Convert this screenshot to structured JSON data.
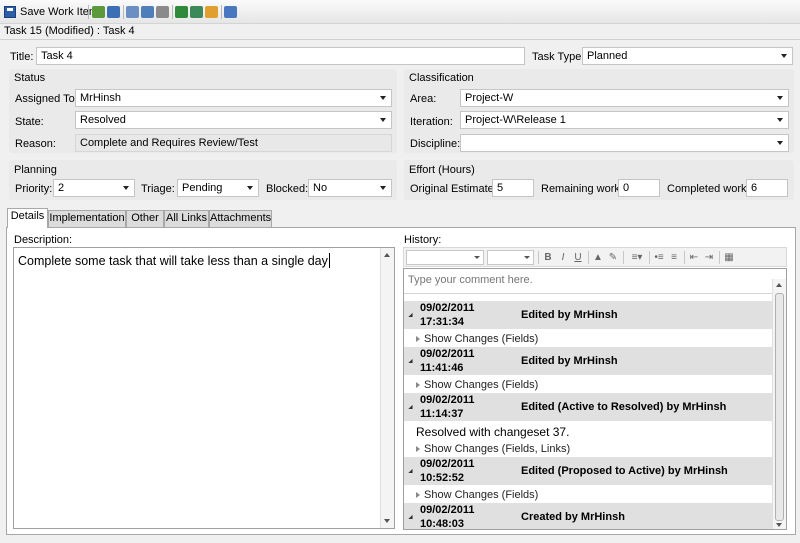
{
  "toolbar": {
    "save_label": "Save Work Item",
    "icons": [
      "refresh-icon",
      "undo-icon",
      "copy-work-item-icon",
      "new-linked-item-icon",
      "print-icon",
      "open-in-excel-icon",
      "open-in-project-icon",
      "send-mail-icon",
      "help-icon"
    ]
  },
  "window": {
    "title": "Task 15 (Modified) : Task 4"
  },
  "form": {
    "title_label": "Title:",
    "title_value": "Task 4",
    "task_type_label": "Task Type:",
    "task_type_value": "Planned"
  },
  "status": {
    "header": "Status",
    "assigned_to_label": "Assigned To:",
    "assigned_to_value": "MrHinsh",
    "state_label": "State:",
    "state_value": "Resolved",
    "reason_label": "Reason:",
    "reason_value": "Complete and Requires Review/Test"
  },
  "classification": {
    "header": "Classification",
    "area_label": "Area:",
    "area_value": "Project-W",
    "iteration_label": "Iteration:",
    "iteration_value": "Project-W\\Release 1",
    "discipline_label": "Discipline:",
    "discipline_value": ""
  },
  "planning": {
    "header": "Planning",
    "priority_label": "Priority:",
    "priority_value": "2",
    "triage_label": "Triage:",
    "triage_value": "Pending",
    "blocked_label": "Blocked:",
    "blocked_value": "No"
  },
  "effort": {
    "header": "Effort (Hours)",
    "original_label": "Original Estimate:",
    "original_value": "5",
    "remaining_label": "Remaining work:",
    "remaining_value": "0",
    "completed_label": "Completed work:",
    "completed_value": "6"
  },
  "tabs": [
    "Details",
    "Implementation",
    "Other",
    "All Links",
    "Attachments"
  ],
  "details": {
    "description_label": "Description:",
    "description_value": "Complete some task that will take less than a single day",
    "history_label": "History:",
    "comment_placeholder": "Type your comment here."
  },
  "rich_toolbar": [
    "B",
    "I",
    "U"
  ],
  "history": [
    {
      "date": "09/02/2011",
      "time": "17:31:34",
      "action": "Edited by MrHinsh",
      "comment": "",
      "changes": "Show Changes (Fields)"
    },
    {
      "date": "09/02/2011",
      "time": "11:41:46",
      "action": "Edited by MrHinsh",
      "comment": "",
      "changes": "Show Changes (Fields)"
    },
    {
      "date": "09/02/2011",
      "time": "11:14:37",
      "action": "Edited (Active to Resolved) by MrHinsh",
      "comment": "Resolved with changeset 37.",
      "changes": "Show Changes (Fields, Links)"
    },
    {
      "date": "09/02/2011",
      "time": "10:52:52",
      "action": "Edited (Proposed to Active) by MrHinsh",
      "comment": "",
      "changes": "Show Changes (Fields)"
    },
    {
      "date": "09/02/2011",
      "time": "10:48:03",
      "action": "Created by MrHinsh",
      "comment": "",
      "changes": ""
    }
  ]
}
